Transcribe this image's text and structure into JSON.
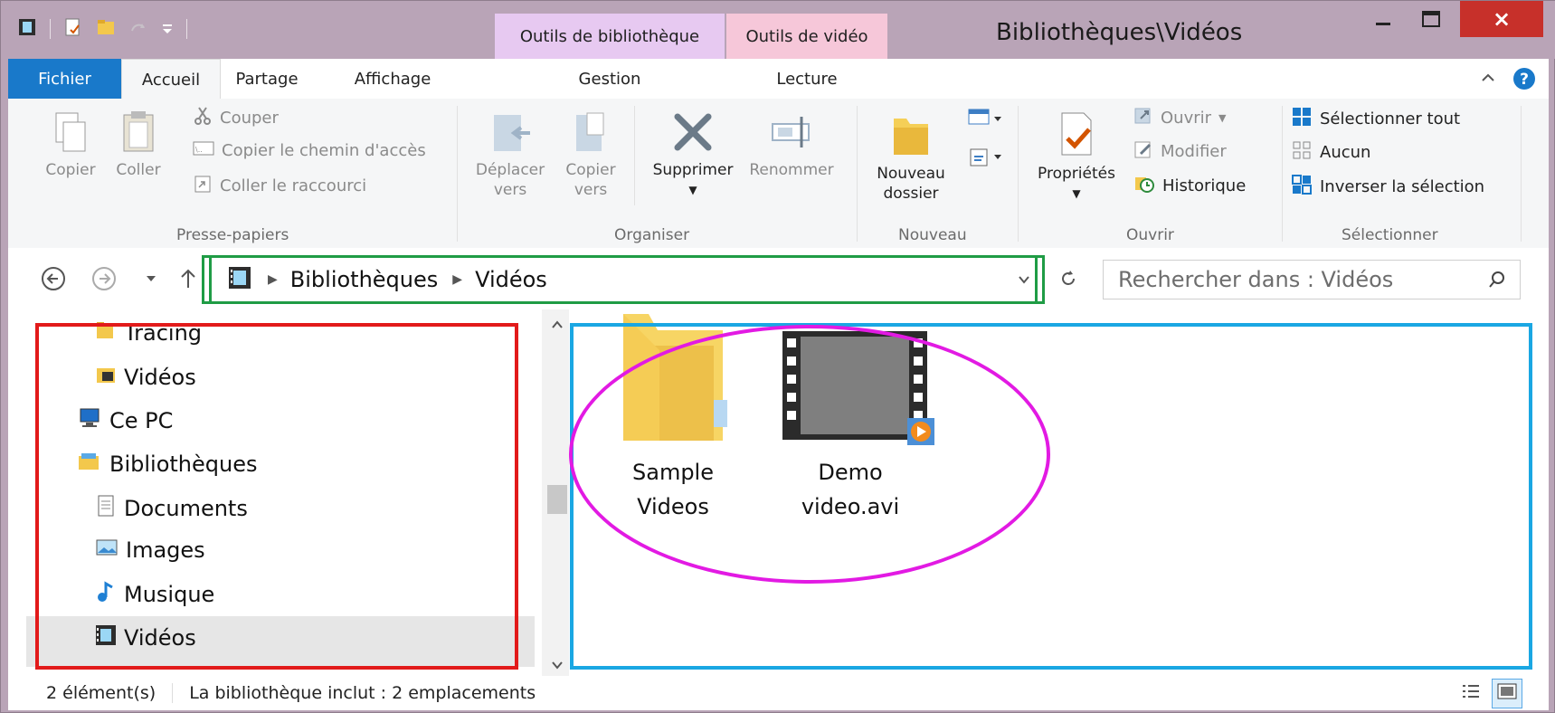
{
  "window": {
    "title": "Bibliothèques\\Vidéos",
    "contextual_tabs": [
      "Outils de bibliothèque",
      "Outils de vidéo"
    ],
    "close_glyph": "×"
  },
  "ribbon": {
    "tabs": [
      "Fichier",
      "Accueil",
      "Partage",
      "Affichage",
      "Gestion",
      "Lecture"
    ],
    "presse_papiers": {
      "copier": "Copier",
      "coller": "Coller",
      "couper": "Couper",
      "copier_chemin": "Copier le chemin d'accès",
      "coller_raccourci": "Coller le raccourci",
      "label": "Presse-papiers"
    },
    "organiser": {
      "deplacer": "Déplacer",
      "deplacer2": "vers",
      "copier_vers": "Copier",
      "copier_vers2": "vers",
      "supprimer": "Supprimer",
      "renommer": "Renommer",
      "label": "Organiser"
    },
    "nouveau": {
      "nouveau_dossier": "Nouveau",
      "nouveau_dossier2": "dossier",
      "label": "Nouveau"
    },
    "ouvrir": {
      "proprietes": "Propriétés",
      "ouvrir": "Ouvrir",
      "modifier": "Modifier",
      "historique": "Historique",
      "label": "Ouvrir"
    },
    "selectionner": {
      "tout": "Sélectionner tout",
      "aucun": "Aucun",
      "inverser": "Inverser la sélection",
      "label": "Sélectionner"
    }
  },
  "address": {
    "path": [
      "Bibliothèques",
      "Vidéos"
    ],
    "search_placeholder": "Rechercher dans : Vidéos"
  },
  "navigation": {
    "items": [
      "Tracing",
      "Vidéos",
      "Ce PC",
      "Bibliothèques",
      "Documents",
      "Images",
      "Musique",
      "Vidéos"
    ],
    "selected": "Vidéos"
  },
  "content": {
    "items": [
      {
        "line1": "Sample",
        "line2": "Videos",
        "type": "folder"
      },
      {
        "line1": "Demo",
        "line2": "video.avi",
        "type": "video"
      }
    ]
  },
  "status": {
    "count": "2 élément(s)",
    "library_info": "La bibliothèque inclut : 2 emplacements"
  },
  "highlight_colors": {
    "address": "#1f9c45",
    "navigation": "#e21a1a",
    "content": "#1aa7e3",
    "items": "#e21ae3"
  }
}
